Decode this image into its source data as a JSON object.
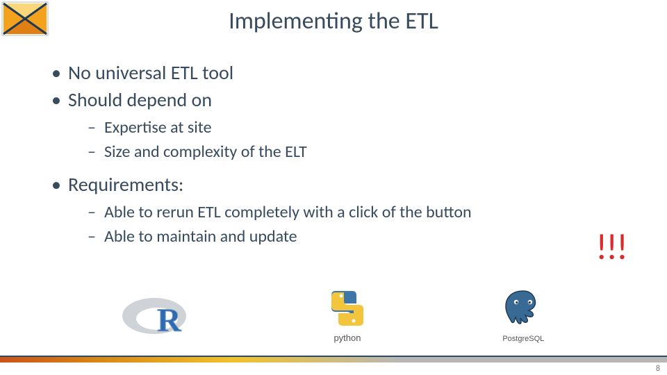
{
  "title": "Implementing the ETL",
  "bullets": {
    "b1": "No universal ETL tool",
    "b2": "Should depend on",
    "b2_sub": {
      "s1": "Expertise at site",
      "s2": "Size and complexity of the ELT"
    },
    "b3": "Requirements:",
    "b3_sub": {
      "s1": "Able to rerun ETL completely with a click of the button",
      "s2": "Able to maintain and update"
    }
  },
  "exclaim": "!!!",
  "logos": {
    "r_letter": "R",
    "python_label": "python",
    "postgres_label": "PostgreSQL"
  },
  "page_number": "8",
  "colors": {
    "text": "#374a5e",
    "accent_red": "#d92b2b"
  },
  "icons": {
    "corner": "x-cross-logo",
    "r": "r-logo",
    "python": "python-logo",
    "postgres": "postgresql-logo"
  }
}
